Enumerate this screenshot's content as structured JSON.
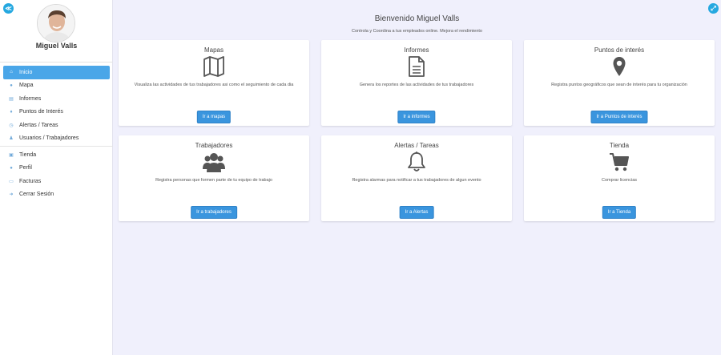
{
  "sidebar": {
    "user_name": "Miguel Valls",
    "collapse_icon": "≪",
    "items_main": [
      {
        "label": "Inicio",
        "icon": "⌂",
        "active": true
      },
      {
        "label": "Mapa",
        "icon": "●"
      },
      {
        "label": "Informes",
        "icon": "▤"
      },
      {
        "label": "Puntos de Interés",
        "icon": "♦"
      },
      {
        "label": "Alertas / Tareas",
        "icon": "◷"
      },
      {
        "label": "Usuarios / Trabajadores",
        "icon": "♟"
      }
    ],
    "items_secondary": [
      {
        "label": "Tienda",
        "icon": "▣"
      },
      {
        "label": "Perfil",
        "icon": "●"
      },
      {
        "label": "Facturas",
        "icon": "▭"
      },
      {
        "label": "Cerrar Sesión",
        "icon": "➜"
      }
    ]
  },
  "header": {
    "title": "Bienvenido Miguel Valls",
    "subtitle": "Controla y Coordina a tus empleados online. Mejora el rendimiento",
    "expand_icon": "⤢"
  },
  "cards": [
    {
      "title": "Mapas",
      "desc": "Visualiza las actividades de tus trabajadores asi como el seguimiento de cada dia",
      "button": "Ir a mapas",
      "icon": "map-icon"
    },
    {
      "title": "Informes",
      "desc": "Genera los reportes de las actividades de tus trabajadores",
      "button": "Ir a informes",
      "icon": "document-icon"
    },
    {
      "title": "Puntos de interés",
      "desc": "Registra puntos geográficos que sean de interés para tu organización",
      "button": "Ir a Puntos de interés",
      "icon": "map-marker-icon"
    },
    {
      "title": "Trabajadores",
      "desc": "Registra personas que formen parte de tu equipo de trabajo",
      "button": "Ir a trabajadores",
      "icon": "users-icon"
    },
    {
      "title": "Alertas / Tareas",
      "desc": "Registra alarmas para notificar a tus trabajadores de algun evento",
      "button": "Ir a Alertas",
      "icon": "bell-icon"
    },
    {
      "title": "Tienda",
      "desc": "Comprar licencias",
      "button": "Ir a Tienda",
      "icon": "shopping-cart-icon"
    }
  ]
}
